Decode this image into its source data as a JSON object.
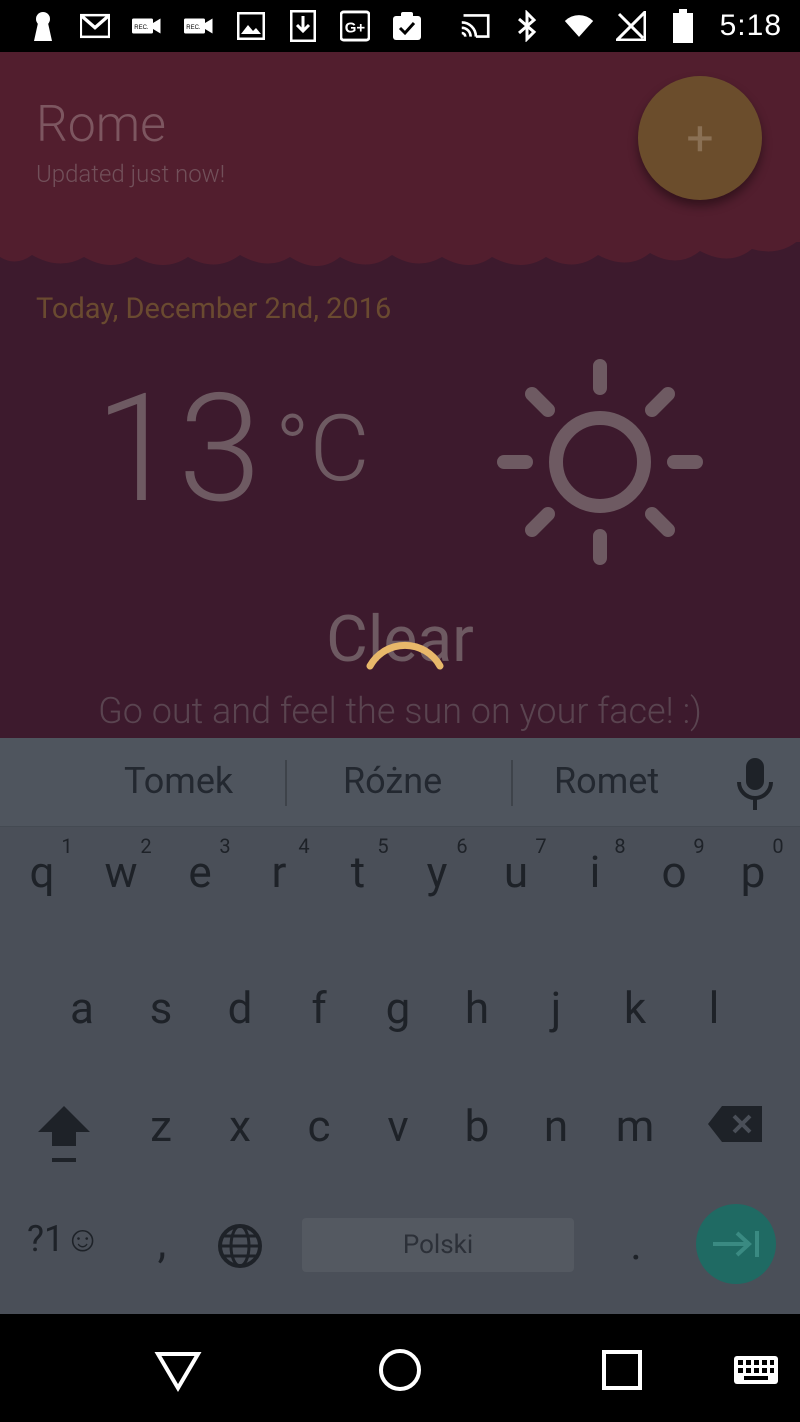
{
  "status_bar": {
    "time": "5:18",
    "left_icons": [
      "keyhole-icon",
      "gmail-icon",
      "rec-icon",
      "rec-icon",
      "image-icon",
      "download-icon",
      "google-plus-icon",
      "clipboard-check-icon"
    ],
    "right_icons": [
      "cast-icon",
      "bluetooth-icon",
      "wifi-icon",
      "signal-icon",
      "battery-icon"
    ]
  },
  "weather": {
    "city": "Rome",
    "updated": "Updated just now!",
    "date": "Today, December 2nd, 2016",
    "temperature": "13",
    "unit": "°C",
    "condition": "Clear",
    "tip": "Go out and feel the sun on your face! :)",
    "fab_label": "+"
  },
  "keyboard": {
    "suggestions": [
      "Tomek",
      "Różne",
      "Romet"
    ],
    "row1": [
      "q",
      "w",
      "e",
      "r",
      "t",
      "y",
      "u",
      "i",
      "o",
      "p"
    ],
    "row1_hints": [
      "1",
      "2",
      "3",
      "4",
      "5",
      "6",
      "7",
      "8",
      "9",
      "0"
    ],
    "row2": [
      "a",
      "s",
      "d",
      "f",
      "g",
      "h",
      "j",
      "k",
      "l"
    ],
    "row3": [
      "z",
      "x",
      "c",
      "v",
      "b",
      "n",
      "m"
    ],
    "symbols_label": "?1☺",
    "comma": ",",
    "period": ".",
    "space_label": "Polski"
  },
  "colors": {
    "header": "#521e2e",
    "background": "#3d1a2d",
    "fab": "#6b4d2c",
    "enter": "#1f6a63",
    "spinner": "#e8b86a"
  }
}
